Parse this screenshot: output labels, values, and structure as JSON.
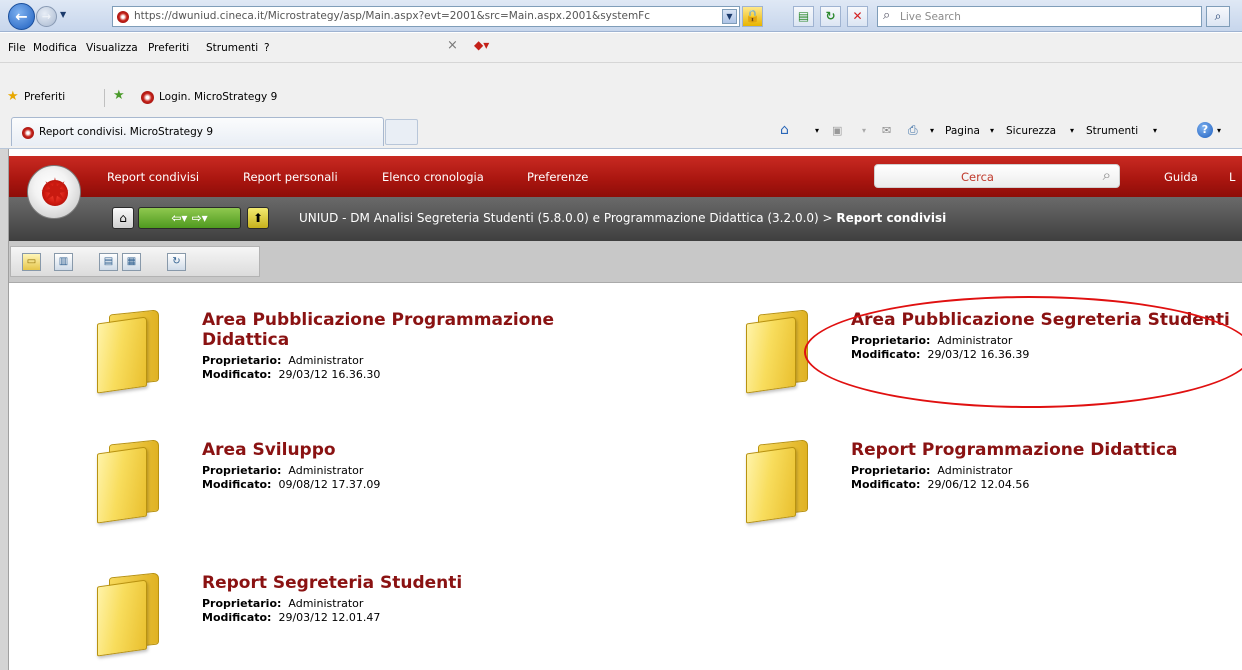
{
  "browser": {
    "url": "https://dwuniud.cineca.it/Microstrategy/asp/Main.aspx?evt=2001&src=Main.aspx.2001&systemFc",
    "search_placeholder": "Live Search",
    "menu": [
      "File",
      "Modifica",
      "Visualizza",
      "Preferiti",
      "Strumenti",
      "?"
    ],
    "favorites_label": "Preferiti",
    "favorite_link": "Login. MicroStrategy 9",
    "tab_title": "Report condivisi. MicroStrategy 9",
    "commands": [
      "Pagina",
      "Sicurezza",
      "Strumenti"
    ],
    "dd": "▾"
  },
  "ms": {
    "nav": [
      "Report condivisi",
      "Report personali",
      "Elenco cronologia",
      "Preferenze"
    ],
    "search_label": "Cerca",
    "help": "Guida",
    "cut_link": "L",
    "breadcrumb_path": "UNIUD - DM Analisi Segreteria Studenti (5.8.0.0) e Programmazione Didattica (3.2.0.0) > ",
    "breadcrumb_current": "Report condivisi"
  },
  "labels": {
    "owner": "Proprietario:",
    "modified": "Modificato:"
  },
  "folders": [
    {
      "title_line1": "Area Pubblicazione Programmazione",
      "title_line2": "Didattica",
      "owner": "Administrator",
      "modified": "29/03/12 16.36.30"
    },
    {
      "title_line1": "Area Pubblicazione Segreteria Studenti",
      "title_line2": "",
      "owner": "Administrator",
      "modified": "29/03/12 16.36.39"
    },
    {
      "title_line1": "Area Sviluppo",
      "title_line2": "",
      "owner": "Administrator",
      "modified": "09/08/12 17.37.09"
    },
    {
      "title_line1": "Report Programmazione Didattica",
      "title_line2": "",
      "owner": "Administrator",
      "modified": "29/06/12 12.04.56"
    },
    {
      "title_line1": "Report Segreteria Studenti",
      "title_line2": "",
      "owner": "Administrator",
      "modified": "29/03/12 12.01.47"
    }
  ],
  "colors": {
    "brand_red": "#a8150f",
    "folder_title": "#8a1212",
    "annotation": "#e01010"
  }
}
